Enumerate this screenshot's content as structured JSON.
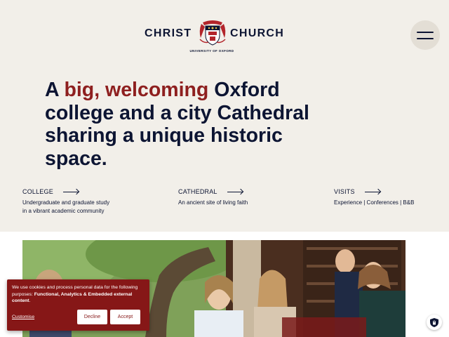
{
  "header": {
    "logo_left": "CHRIST",
    "logo_right": "CHURCH",
    "logo_sub": "UNIVERSITY OF OXFORD",
    "menu_icon": "hamburger-menu-icon"
  },
  "hero": {
    "headline_pre": "A ",
    "headline_accent": "big, welcoming",
    "headline_post": " Oxford college and a city Cathedral sharing a unique historic space."
  },
  "sections": [
    {
      "title": "COLLEGE",
      "text": "Undergraduate and graduate study in a vibrant academic community"
    },
    {
      "title": "CATHEDRAL",
      "text": "An ancient site of living faith"
    },
    {
      "title": "VISITS",
      "text": "Experience | Conferences | B&B"
    }
  ],
  "cookie_banner": {
    "text_pre": "We use cookies and process personal data for the following purposes: ",
    "text_bold": "Functional, Analytics & Embedded external content",
    "text_post": ".",
    "customise": "Customise",
    "decline": "Decline",
    "accept": "Accept"
  },
  "colors": {
    "background": "#f2efe9",
    "navy": "#0d1533",
    "accent_red": "#8e1f1f",
    "cookie_red": "#861717"
  },
  "icons": [
    "crest-logo-icon",
    "hamburger-menu-icon",
    "arrow-right-icon",
    "privacy-shield-icon"
  ]
}
